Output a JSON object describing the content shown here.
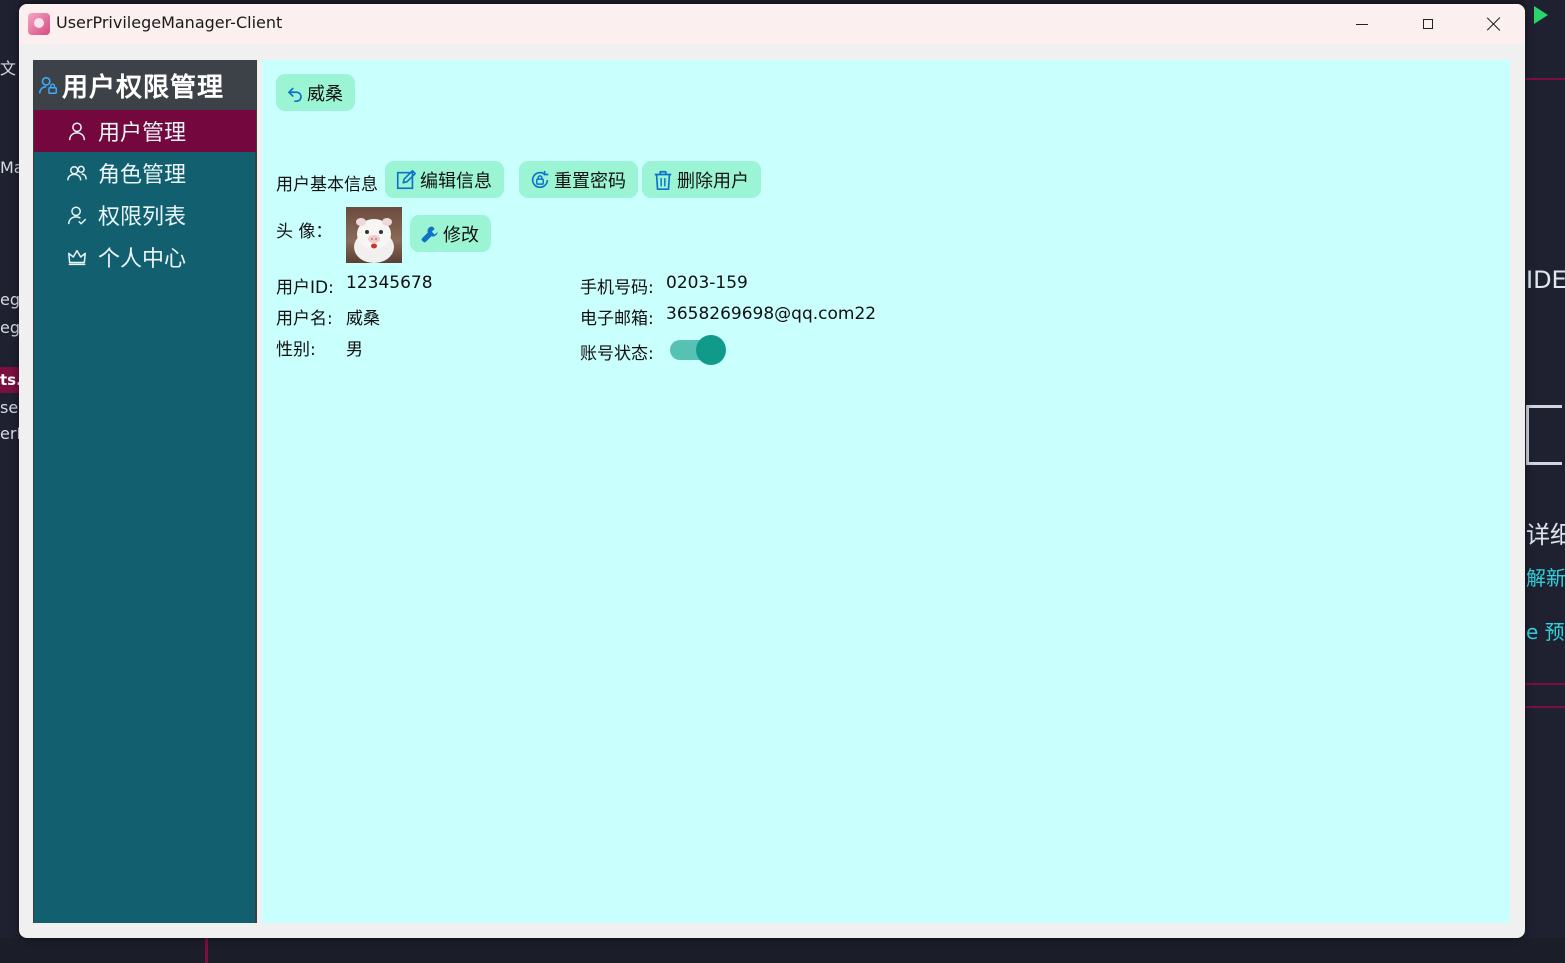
{
  "window": {
    "title": "UserPrivilegeManager-Client"
  },
  "sidebar": {
    "title": "用户权限管理",
    "items": [
      {
        "label": "用户管理",
        "icon": "user-icon",
        "active": true
      },
      {
        "label": "角色管理",
        "icon": "users-icon",
        "active": false
      },
      {
        "label": "权限列表",
        "icon": "user-check-icon",
        "active": false
      },
      {
        "label": "个人中心",
        "icon": "crown-icon",
        "active": false
      }
    ]
  },
  "content": {
    "back_label": "威桑",
    "section_title": "用户基本信息",
    "edit_label": "编辑信息",
    "reset_password_label": "重置密码",
    "delete_user_label": "删除用户",
    "avatar_label": "头 像：",
    "modify_avatar_label": "修改",
    "fields": {
      "user_id_label": "用户ID:",
      "user_id": "12345678",
      "username_label": "用户名:",
      "username": "威桑",
      "gender_label": "性别:",
      "gender": "男",
      "phone_label": "手机号码:",
      "phone": "0203-159",
      "email_label": "电子邮箱:",
      "email": "3658269698@qq.com22",
      "status_label": "账号状态:",
      "status_enabled": true
    }
  },
  "colors": {
    "sidebar_bg": "#12606f",
    "sidebar_active": "#75073f",
    "sidebar_header": "#3d4249",
    "content_bg": "#c9fffd",
    "button_bg": "#9bf5d4",
    "toggle_on": "#0f9a8a"
  },
  "background": {
    "right_fragments": [
      "IDE",
      "详细",
      "解新",
      "e 预"
    ],
    "left_fragments": [
      "文",
      "Ma",
      "ege",
      "ege",
      "ts.",
      "se",
      "erP"
    ]
  }
}
